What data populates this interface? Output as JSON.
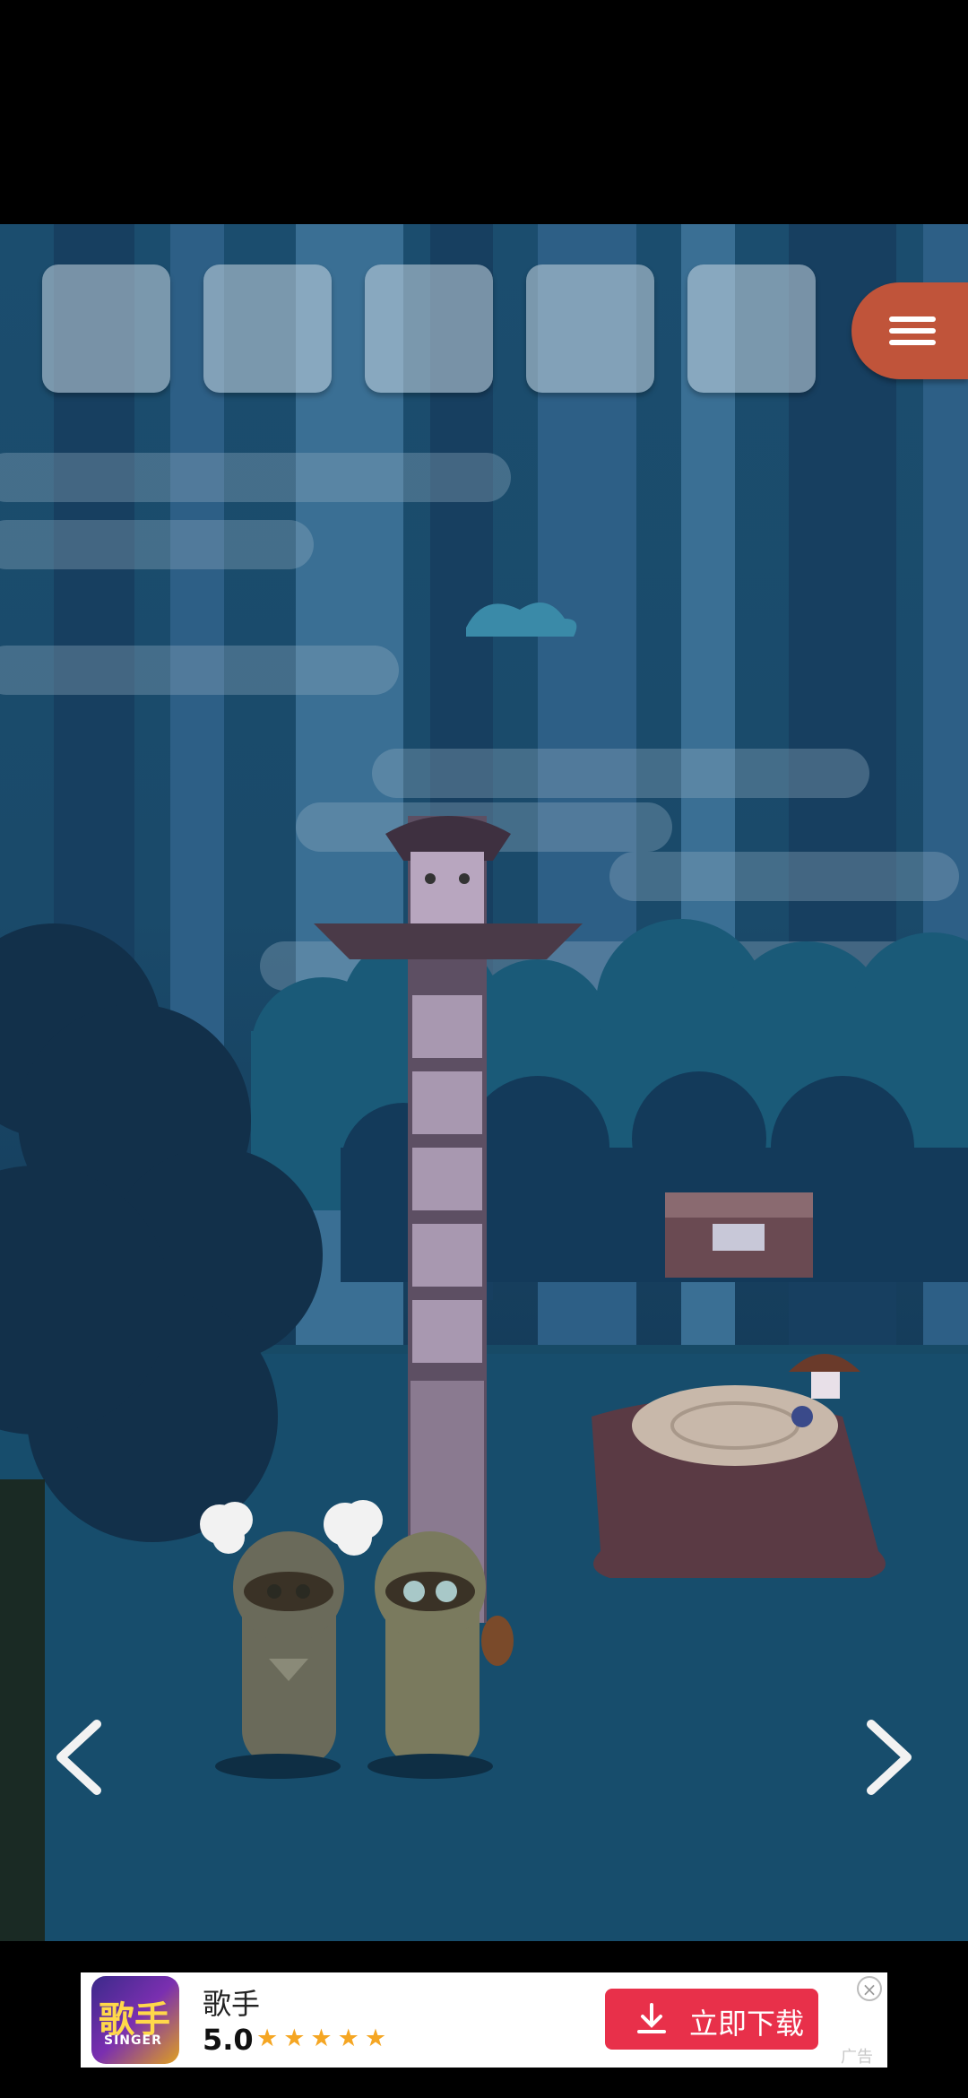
{
  "game": {
    "inventory": {
      "slots": [
        {
          "item": null
        },
        {
          "item": null
        },
        {
          "item": null
        },
        {
          "item": null
        },
        {
          "item": null
        }
      ]
    },
    "menu_icon": "hamburger-icon",
    "nav": {
      "prev_icon": "chevron-left-icon",
      "next_icon": "chevron-right-icon"
    },
    "scene_objects": [
      "totem-pole",
      "treasure-chest",
      "tree-stump",
      "raccoon-left",
      "raccoon-right",
      "beetle",
      "mushrooms"
    ]
  },
  "ad": {
    "app_name": "歌手",
    "icon_text_top": "歌手",
    "icon_text_bottom": "SINGER",
    "rating": "5.0",
    "stars": "★★★★★",
    "cta_label": "立即下载",
    "badge": "广告",
    "close_icon": "close-icon"
  },
  "colors": {
    "menu_button": "#c0543a",
    "ad_cta": "#e8304a",
    "star": "#f5a623"
  }
}
